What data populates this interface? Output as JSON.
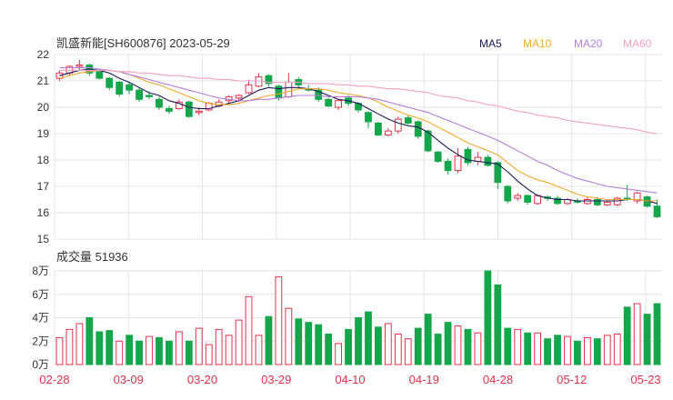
{
  "header": {
    "title": "凯盛新能[SH600876] 2023-05-29",
    "ma_labels": [
      {
        "label": "MA5",
        "color": "#1a1a5a"
      },
      {
        "label": "MA10",
        "color": "#f0a830"
      },
      {
        "label": "MA20",
        "color": "#b27fd8"
      },
      {
        "label": "MA60",
        "color": "#f39fc4"
      }
    ]
  },
  "volume_panel": {
    "label": "成交量 51936"
  },
  "colors": {
    "up": "#e0324a",
    "down": "#13a64a",
    "grid": "#e4e4e4",
    "axis_text": "#333333",
    "date_text": "#e0324a"
  },
  "chart_data": [
    {
      "type": "candlestick",
      "ylim": [
        15,
        22
      ],
      "yticks": [
        "22",
        "21",
        "20",
        "19",
        "18",
        "17",
        "16",
        "15"
      ],
      "dates": [
        "02-28",
        "03-09",
        "03-20",
        "03-29",
        "04-10",
        "04-19",
        "04-28",
        "05-12",
        "05-23"
      ],
      "ohlc": [
        [
          21.1,
          21.4,
          21.0,
          21.3
        ],
        [
          21.3,
          21.6,
          21.2,
          21.55
        ],
        [
          21.55,
          21.8,
          21.4,
          21.6
        ],
        [
          21.6,
          21.65,
          21.2,
          21.3
        ],
        [
          21.35,
          21.45,
          21.05,
          21.1
        ],
        [
          21.1,
          21.15,
          20.65,
          20.75
        ],
        [
          20.95,
          21.0,
          20.4,
          20.5
        ],
        [
          20.85,
          20.95,
          20.5,
          20.65
        ],
        [
          20.65,
          20.75,
          20.2,
          20.3
        ],
        [
          20.45,
          20.6,
          20.3,
          20.4
        ],
        [
          20.3,
          20.4,
          19.9,
          20.0
        ],
        [
          19.95,
          20.05,
          19.75,
          19.85
        ],
        [
          19.95,
          20.3,
          19.9,
          20.2
        ],
        [
          20.2,
          20.25,
          19.6,
          19.65
        ],
        [
          19.8,
          20.0,
          19.7,
          19.85
        ],
        [
          19.9,
          20.2,
          19.85,
          20.15
        ],
        [
          20.05,
          20.3,
          20.0,
          20.2
        ],
        [
          20.25,
          20.45,
          20.15,
          20.4
        ],
        [
          20.35,
          20.5,
          20.2,
          20.45
        ],
        [
          20.55,
          21.05,
          20.5,
          20.85
        ],
        [
          20.8,
          21.3,
          20.75,
          21.15
        ],
        [
          21.2,
          21.25,
          20.8,
          20.9
        ],
        [
          20.8,
          20.85,
          20.25,
          20.35
        ],
        [
          20.4,
          21.3,
          20.35,
          20.95
        ],
        [
          21.05,
          21.15,
          20.7,
          20.85
        ],
        [
          20.7,
          20.85,
          20.6,
          20.65
        ],
        [
          20.65,
          20.75,
          20.2,
          20.3
        ],
        [
          20.3,
          20.35,
          20.0,
          20.05
        ],
        [
          20.0,
          20.3,
          19.9,
          20.25
        ],
        [
          20.35,
          20.45,
          20.05,
          20.15
        ],
        [
          20.15,
          20.2,
          19.8,
          19.9
        ],
        [
          19.8,
          19.85,
          19.2,
          19.45
        ],
        [
          19.4,
          19.45,
          18.9,
          18.95
        ],
        [
          18.95,
          19.2,
          18.9,
          19.1
        ],
        [
          19.1,
          19.65,
          19.0,
          19.55
        ],
        [
          19.6,
          19.7,
          19.35,
          19.4
        ],
        [
          19.45,
          19.5,
          18.8,
          18.9
        ],
        [
          19.1,
          19.15,
          18.3,
          18.35
        ],
        [
          18.3,
          18.35,
          17.9,
          17.95
        ],
        [
          17.95,
          18.05,
          17.45,
          17.6
        ],
        [
          17.6,
          18.45,
          17.5,
          18.15
        ],
        [
          18.4,
          18.5,
          17.8,
          17.9
        ],
        [
          17.95,
          18.3,
          17.8,
          18.1
        ],
        [
          18.1,
          18.2,
          17.75,
          17.8
        ],
        [
          17.9,
          17.95,
          16.9,
          17.15
        ],
        [
          17.0,
          17.05,
          16.35,
          16.45
        ],
        [
          16.55,
          16.75,
          16.45,
          16.65
        ],
        [
          16.65,
          16.7,
          16.3,
          16.4
        ],
        [
          16.35,
          16.7,
          16.3,
          16.65
        ],
        [
          16.6,
          16.65,
          16.45,
          16.55
        ],
        [
          16.55,
          16.65,
          16.3,
          16.35
        ],
        [
          16.35,
          16.55,
          16.3,
          16.5
        ],
        [
          16.45,
          16.55,
          16.35,
          16.4
        ],
        [
          16.35,
          16.6,
          16.3,
          16.5
        ],
        [
          16.5,
          16.6,
          16.25,
          16.3
        ],
        [
          16.3,
          16.45,
          16.25,
          16.4
        ],
        [
          16.3,
          16.6,
          16.25,
          16.55
        ],
        [
          16.55,
          17.05,
          16.45,
          16.5
        ],
        [
          16.45,
          16.8,
          16.35,
          16.75
        ],
        [
          16.6,
          16.65,
          16.2,
          16.25
        ],
        [
          16.25,
          16.5,
          15.8,
          15.85
        ]
      ],
      "series": [
        {
          "name": "MA5",
          "color": "#1a1a5a",
          "values": [
            21.2,
            21.3,
            21.4,
            21.45,
            21.4,
            21.3,
            21.1,
            20.95,
            20.75,
            20.55,
            20.45,
            20.25,
            20.15,
            20.0,
            19.95,
            19.95,
            20.05,
            20.15,
            20.25,
            20.45,
            20.65,
            20.75,
            20.7,
            20.75,
            20.75,
            20.7,
            20.6,
            20.45,
            20.3,
            20.25,
            20.15,
            19.95,
            19.75,
            19.55,
            19.4,
            19.3,
            19.25,
            19.05,
            18.75,
            18.45,
            18.2,
            18.0,
            17.95,
            17.9,
            17.85,
            17.55,
            17.2,
            16.9,
            16.65,
            16.55,
            16.5,
            16.5,
            16.45,
            16.45,
            16.45,
            16.45,
            16.45,
            16.5,
            16.5,
            16.45,
            16.35
          ]
        },
        {
          "name": "MA10",
          "color": "#f0a830",
          "values": [
            21.1,
            21.2,
            21.3,
            21.35,
            21.4,
            21.4,
            21.35,
            21.25,
            21.1,
            20.95,
            20.85,
            20.7,
            20.55,
            20.4,
            20.25,
            20.15,
            20.1,
            20.1,
            20.15,
            20.25,
            20.35,
            20.45,
            20.5,
            20.6,
            20.7,
            20.7,
            20.7,
            20.65,
            20.55,
            20.5,
            20.45,
            20.35,
            20.2,
            20.0,
            19.85,
            19.7,
            19.6,
            19.45,
            19.25,
            19.05,
            18.85,
            18.65,
            18.5,
            18.35,
            18.2,
            17.9,
            17.6,
            17.4,
            17.25,
            17.15,
            17.0,
            16.85,
            16.7,
            16.6,
            16.55,
            16.5,
            16.5,
            16.5,
            16.5,
            16.45,
            16.45
          ]
        },
        {
          "name": "MA20",
          "color": "#b27fd8",
          "values": [
            21.5,
            21.5,
            21.5,
            21.5,
            21.45,
            21.4,
            21.35,
            21.25,
            21.15,
            21.05,
            20.95,
            20.85,
            20.75,
            20.65,
            20.55,
            20.45,
            20.35,
            20.3,
            20.25,
            20.25,
            20.3,
            20.3,
            20.35,
            20.4,
            20.45,
            20.45,
            20.45,
            20.4,
            20.4,
            20.4,
            20.4,
            20.35,
            20.3,
            20.2,
            20.1,
            20.0,
            19.9,
            19.8,
            19.65,
            19.5,
            19.35,
            19.2,
            19.05,
            18.9,
            18.75,
            18.55,
            18.35,
            18.15,
            17.95,
            17.8,
            17.6,
            17.45,
            17.3,
            17.2,
            17.1,
            17.0,
            16.95,
            16.9,
            16.85,
            16.8,
            16.75
          ]
        },
        {
          "name": "MA60",
          "color": "#f39fc4",
          "values": [
            21.4,
            21.4,
            21.4,
            21.4,
            21.4,
            21.4,
            21.35,
            21.35,
            21.3,
            21.3,
            21.25,
            21.2,
            21.2,
            21.15,
            21.1,
            21.1,
            21.05,
            21.05,
            21.0,
            21.0,
            21.0,
            20.95,
            20.95,
            20.95,
            20.95,
            20.9,
            20.9,
            20.9,
            20.85,
            20.85,
            20.8,
            20.8,
            20.75,
            20.7,
            20.7,
            20.65,
            20.6,
            20.55,
            20.45,
            20.4,
            20.35,
            20.25,
            20.2,
            20.1,
            20.05,
            19.95,
            19.85,
            19.8,
            19.7,
            19.65,
            19.6,
            19.5,
            19.45,
            19.4,
            19.35,
            19.3,
            19.25,
            19.2,
            19.15,
            19.05,
            19.0
          ]
        }
      ]
    },
    {
      "type": "bar",
      "title": "成交量 51936",
      "ylim": [
        0,
        8
      ],
      "yticks": [
        "8万",
        "6万",
        "4万",
        "2万",
        "0万"
      ],
      "values": [
        2.3,
        3.0,
        3.5,
        4.0,
        2.8,
        2.9,
        2.0,
        2.5,
        2.0,
        2.4,
        2.3,
        2.0,
        2.8,
        2.0,
        3.1,
        1.7,
        3.0,
        2.5,
        3.8,
        5.8,
        2.5,
        4.1,
        7.5,
        4.8,
        3.9,
        3.6,
        3.4,
        2.6,
        1.8,
        3.0,
        4.0,
        4.5,
        3.2,
        3.5,
        2.6,
        2.2,
        3.1,
        4.3,
        2.6,
        3.6,
        3.3,
        3.0,
        2.7,
        8.0,
        6.8,
        3.1,
        3.0,
        2.7,
        2.7,
        2.2,
        2.5,
        2.4,
        2.0,
        2.3,
        2.2,
        2.5,
        2.6,
        4.9,
        5.2,
        4.3,
        5.2
      ],
      "up": [
        1,
        1,
        1,
        0,
        0,
        0,
        1,
        0,
        0,
        1,
        0,
        0,
        1,
        0,
        1,
        1,
        1,
        1,
        1,
        1,
        1,
        0,
        1,
        1,
        0,
        0,
        0,
        0,
        1,
        0,
        0,
        0,
        0,
        1,
        1,
        1,
        0,
        0,
        0,
        0,
        1,
        0,
        1,
        0,
        0,
        0,
        1,
        0,
        1,
        0,
        0,
        1,
        0,
        1,
        0,
        1,
        1,
        0,
        1,
        0,
        0
      ]
    }
  ]
}
